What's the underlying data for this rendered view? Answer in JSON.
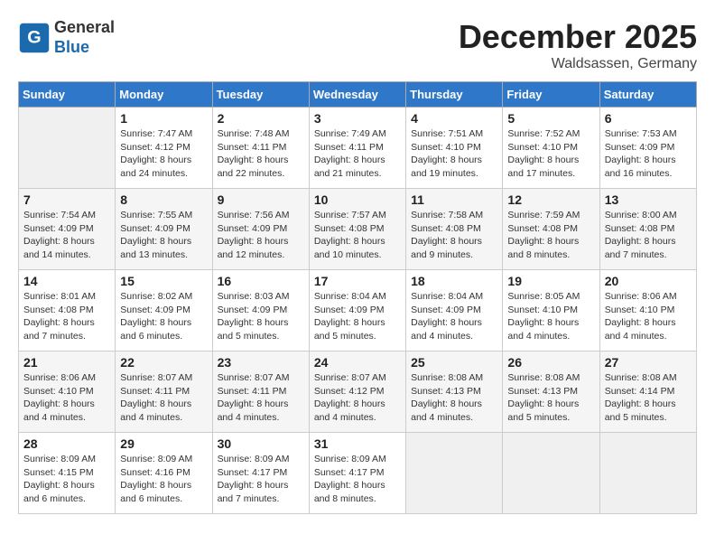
{
  "header": {
    "logo_line1": "General",
    "logo_line2": "Blue",
    "month_title": "December 2025",
    "location": "Waldsassen, Germany"
  },
  "weekdays": [
    "Sunday",
    "Monday",
    "Tuesday",
    "Wednesday",
    "Thursday",
    "Friday",
    "Saturday"
  ],
  "weeks": [
    [
      {
        "day": "",
        "info": ""
      },
      {
        "day": "1",
        "info": "Sunrise: 7:47 AM\nSunset: 4:12 PM\nDaylight: 8 hours\nand 24 minutes."
      },
      {
        "day": "2",
        "info": "Sunrise: 7:48 AM\nSunset: 4:11 PM\nDaylight: 8 hours\nand 22 minutes."
      },
      {
        "day": "3",
        "info": "Sunrise: 7:49 AM\nSunset: 4:11 PM\nDaylight: 8 hours\nand 21 minutes."
      },
      {
        "day": "4",
        "info": "Sunrise: 7:51 AM\nSunset: 4:10 PM\nDaylight: 8 hours\nand 19 minutes."
      },
      {
        "day": "5",
        "info": "Sunrise: 7:52 AM\nSunset: 4:10 PM\nDaylight: 8 hours\nand 17 minutes."
      },
      {
        "day": "6",
        "info": "Sunrise: 7:53 AM\nSunset: 4:09 PM\nDaylight: 8 hours\nand 16 minutes."
      }
    ],
    [
      {
        "day": "7",
        "info": "Sunrise: 7:54 AM\nSunset: 4:09 PM\nDaylight: 8 hours\nand 14 minutes."
      },
      {
        "day": "8",
        "info": "Sunrise: 7:55 AM\nSunset: 4:09 PM\nDaylight: 8 hours\nand 13 minutes."
      },
      {
        "day": "9",
        "info": "Sunrise: 7:56 AM\nSunset: 4:09 PM\nDaylight: 8 hours\nand 12 minutes."
      },
      {
        "day": "10",
        "info": "Sunrise: 7:57 AM\nSunset: 4:08 PM\nDaylight: 8 hours\nand 10 minutes."
      },
      {
        "day": "11",
        "info": "Sunrise: 7:58 AM\nSunset: 4:08 PM\nDaylight: 8 hours\nand 9 minutes."
      },
      {
        "day": "12",
        "info": "Sunrise: 7:59 AM\nSunset: 4:08 PM\nDaylight: 8 hours\nand 8 minutes."
      },
      {
        "day": "13",
        "info": "Sunrise: 8:00 AM\nSunset: 4:08 PM\nDaylight: 8 hours\nand 7 minutes."
      }
    ],
    [
      {
        "day": "14",
        "info": "Sunrise: 8:01 AM\nSunset: 4:08 PM\nDaylight: 8 hours\nand 7 minutes."
      },
      {
        "day": "15",
        "info": "Sunrise: 8:02 AM\nSunset: 4:09 PM\nDaylight: 8 hours\nand 6 minutes."
      },
      {
        "day": "16",
        "info": "Sunrise: 8:03 AM\nSunset: 4:09 PM\nDaylight: 8 hours\nand 5 minutes."
      },
      {
        "day": "17",
        "info": "Sunrise: 8:04 AM\nSunset: 4:09 PM\nDaylight: 8 hours\nand 5 minutes."
      },
      {
        "day": "18",
        "info": "Sunrise: 8:04 AM\nSunset: 4:09 PM\nDaylight: 8 hours\nand 4 minutes."
      },
      {
        "day": "19",
        "info": "Sunrise: 8:05 AM\nSunset: 4:10 PM\nDaylight: 8 hours\nand 4 minutes."
      },
      {
        "day": "20",
        "info": "Sunrise: 8:06 AM\nSunset: 4:10 PM\nDaylight: 8 hours\nand 4 minutes."
      }
    ],
    [
      {
        "day": "21",
        "info": "Sunrise: 8:06 AM\nSunset: 4:10 PM\nDaylight: 8 hours\nand 4 minutes."
      },
      {
        "day": "22",
        "info": "Sunrise: 8:07 AM\nSunset: 4:11 PM\nDaylight: 8 hours\nand 4 minutes."
      },
      {
        "day": "23",
        "info": "Sunrise: 8:07 AM\nSunset: 4:11 PM\nDaylight: 8 hours\nand 4 minutes."
      },
      {
        "day": "24",
        "info": "Sunrise: 8:07 AM\nSunset: 4:12 PM\nDaylight: 8 hours\nand 4 minutes."
      },
      {
        "day": "25",
        "info": "Sunrise: 8:08 AM\nSunset: 4:13 PM\nDaylight: 8 hours\nand 4 minutes."
      },
      {
        "day": "26",
        "info": "Sunrise: 8:08 AM\nSunset: 4:13 PM\nDaylight: 8 hours\nand 5 minutes."
      },
      {
        "day": "27",
        "info": "Sunrise: 8:08 AM\nSunset: 4:14 PM\nDaylight: 8 hours\nand 5 minutes."
      }
    ],
    [
      {
        "day": "28",
        "info": "Sunrise: 8:09 AM\nSunset: 4:15 PM\nDaylight: 8 hours\nand 6 minutes."
      },
      {
        "day": "29",
        "info": "Sunrise: 8:09 AM\nSunset: 4:16 PM\nDaylight: 8 hours\nand 6 minutes."
      },
      {
        "day": "30",
        "info": "Sunrise: 8:09 AM\nSunset: 4:17 PM\nDaylight: 8 hours\nand 7 minutes."
      },
      {
        "day": "31",
        "info": "Sunrise: 8:09 AM\nSunset: 4:17 PM\nDaylight: 8 hours\nand 8 minutes."
      },
      {
        "day": "",
        "info": ""
      },
      {
        "day": "",
        "info": ""
      },
      {
        "day": "",
        "info": ""
      }
    ]
  ]
}
